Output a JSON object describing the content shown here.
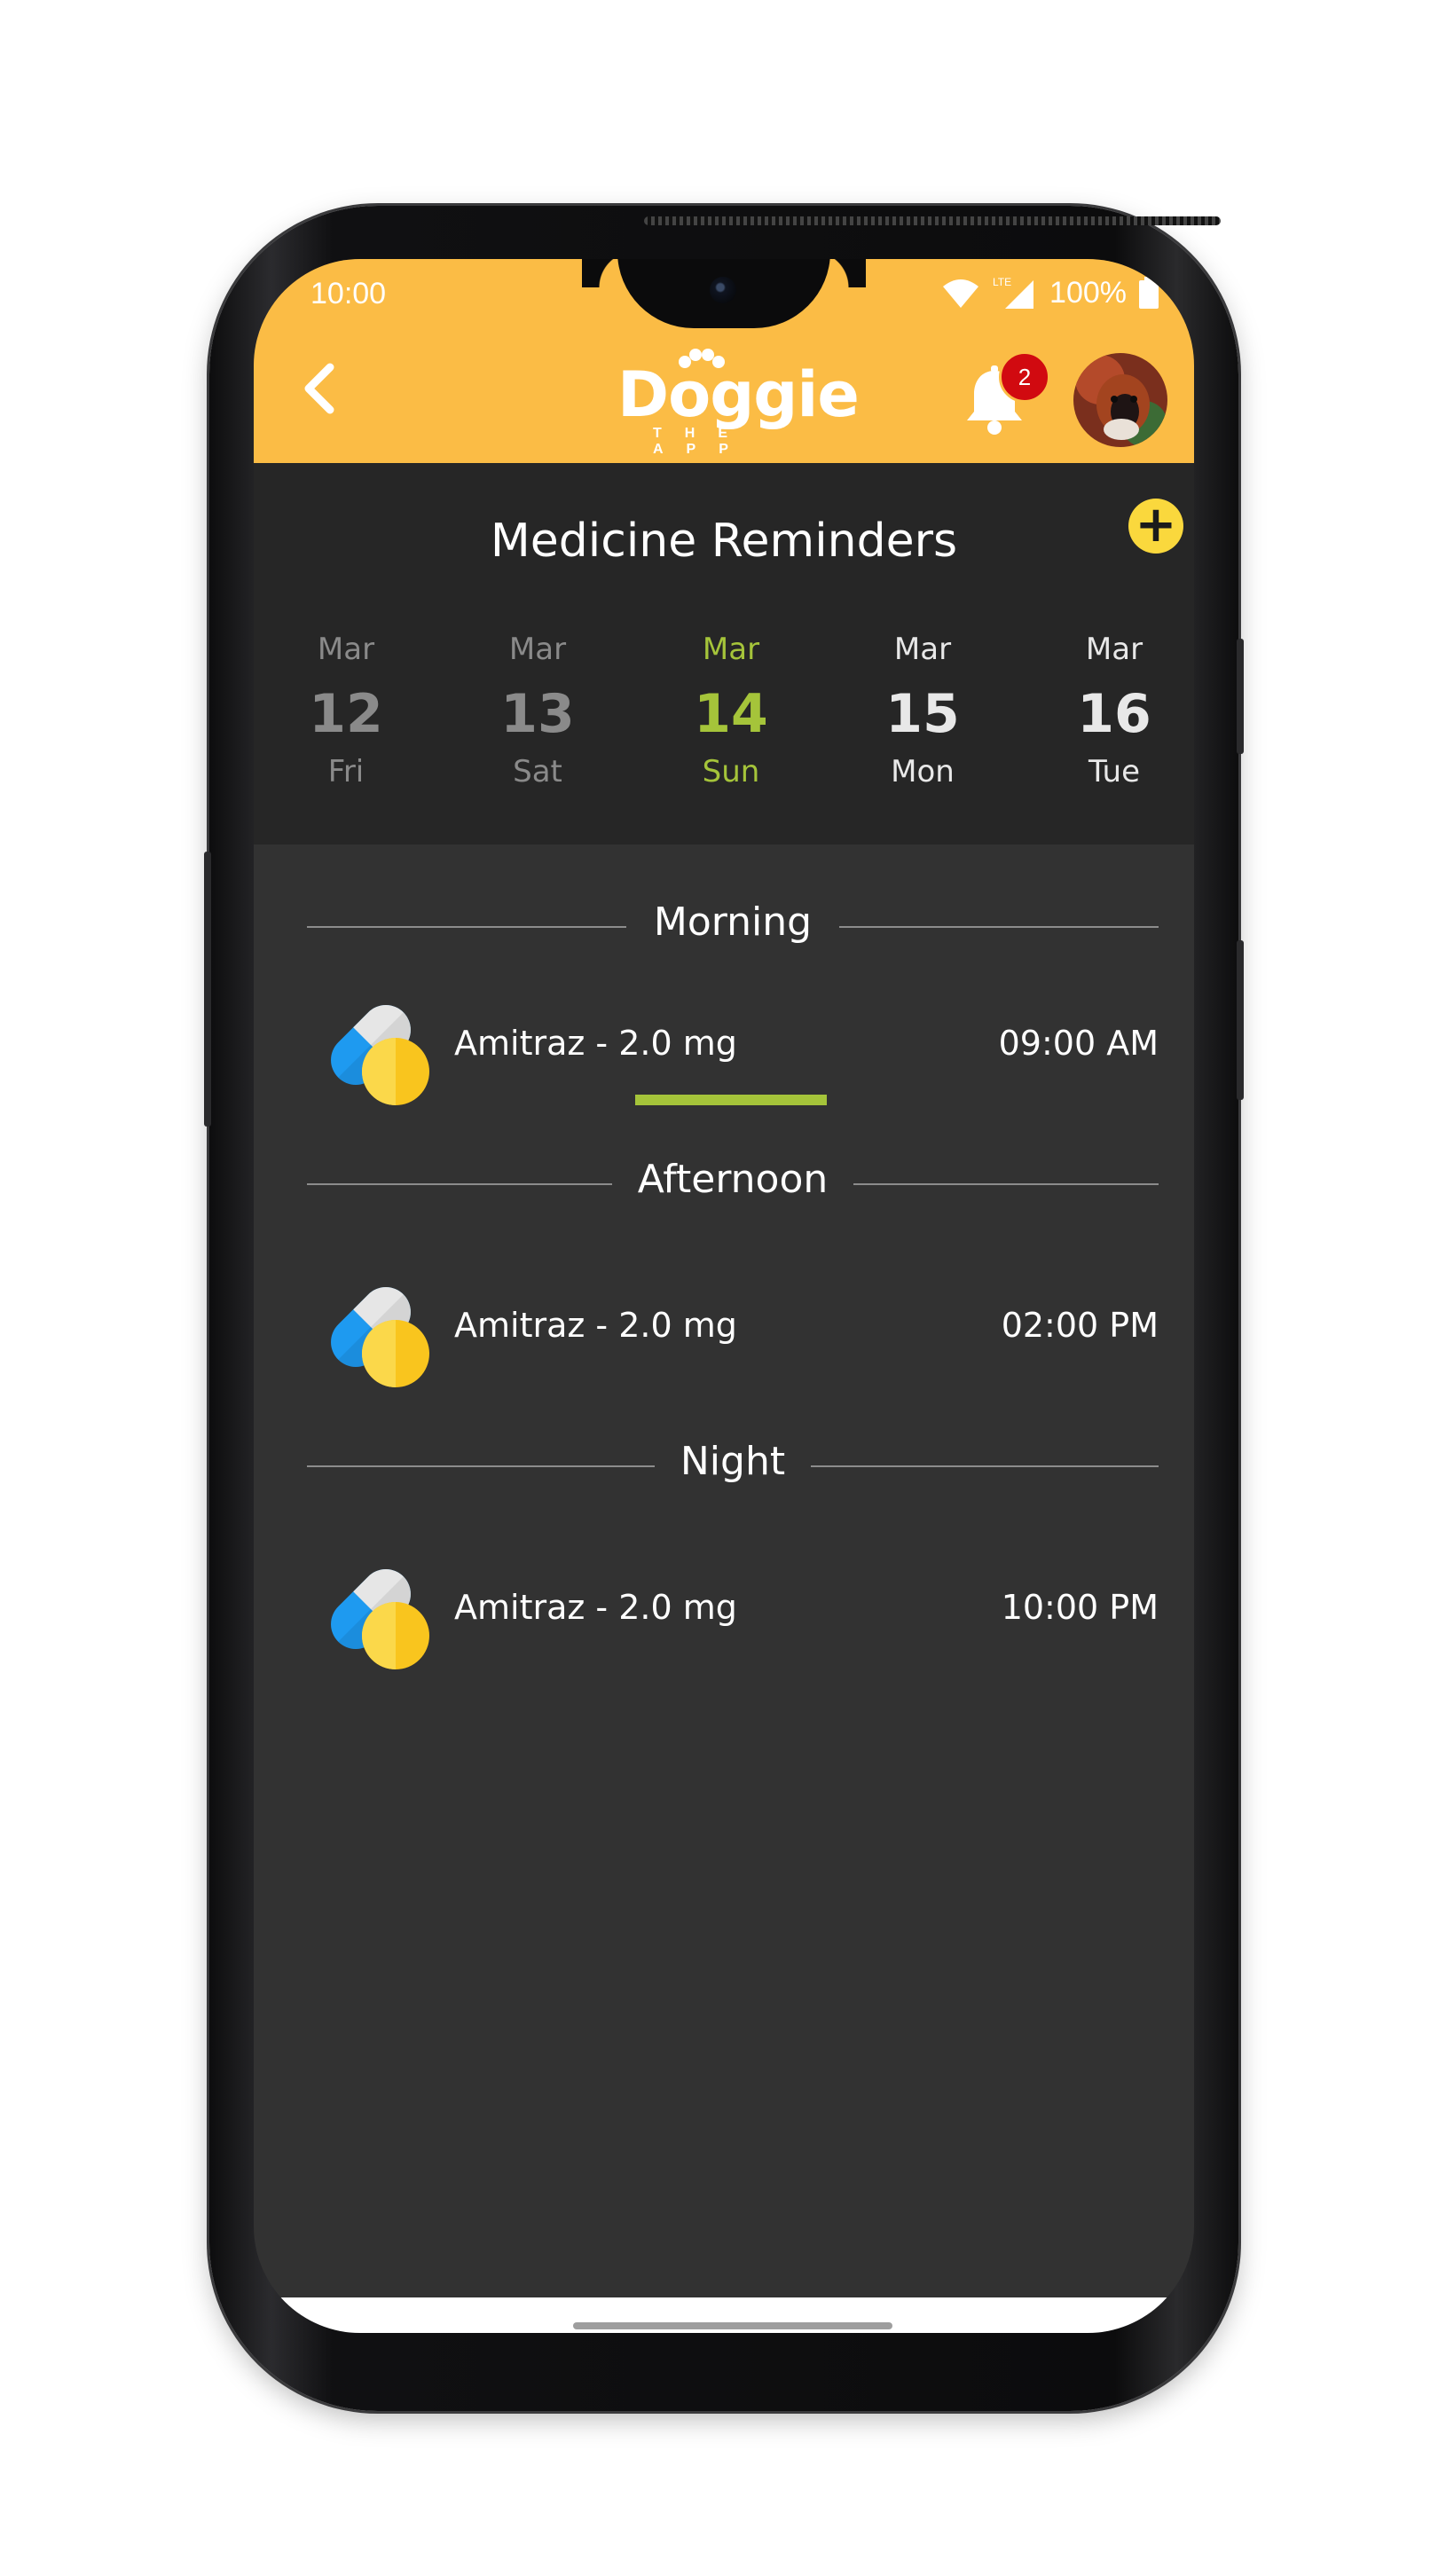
{
  "status_bar": {
    "time": "10:00",
    "battery": "100%",
    "network": "LTE"
  },
  "header": {
    "logo_text": "Doggie",
    "logo_sub": "THE APP",
    "notification_count": "2",
    "brand_color": "#fbbc45"
  },
  "page": {
    "title": "Medicine Reminders",
    "add_label": "+"
  },
  "days": [
    {
      "month": "Mar",
      "date": "12",
      "weekday": "Fri",
      "state": "past"
    },
    {
      "month": "Mar",
      "date": "13",
      "weekday": "Sat",
      "state": "past"
    },
    {
      "month": "Mar",
      "date": "14",
      "weekday": "Sun",
      "state": "active"
    },
    {
      "month": "Mar",
      "date": "15",
      "weekday": "Mon",
      "state": "future"
    },
    {
      "month": "Mar",
      "date": "16",
      "weekday": "Tue",
      "state": "future"
    }
  ],
  "sections": [
    {
      "label": "Morning",
      "items": [
        {
          "name": "Amitraz - 2.0 mg",
          "time": "09:00 AM",
          "icon": "pill-icon"
        }
      ]
    },
    {
      "label": "Afternoon",
      "items": [
        {
          "name": "Amitraz - 2.0 mg",
          "time": "02:00 PM",
          "icon": "pill-icon"
        }
      ]
    },
    {
      "label": "Night",
      "items": [
        {
          "name": "Amitraz - 2.0 mg",
          "time": "10:00 PM",
          "icon": "pill-icon"
        }
      ]
    }
  ],
  "colors": {
    "accent_green": "#a5c43a",
    "add_button": "#fad83d",
    "badge_red": "#d10a10"
  }
}
